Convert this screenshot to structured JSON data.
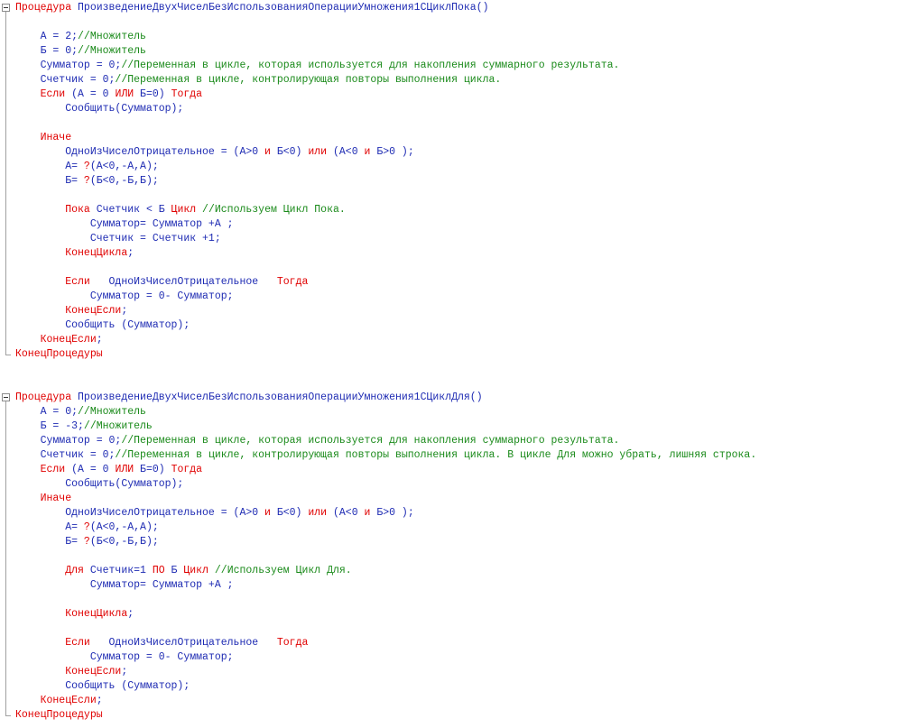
{
  "editor": {
    "colors": {
      "keyword": "#e00000",
      "identifier": "#1e2bb3",
      "comment": "#1a8a1a",
      "background": "#ffffff"
    },
    "blocks": [
      {
        "name": "procedure-while",
        "lines": [
          [
            [
              "kw",
              "Процедура"
            ],
            [
              "id",
              " ПроизведениеДвухЧиселБезИспользованияОперацииУмножения1СЦиклПока()"
            ]
          ],
          [],
          [
            [
              "id",
              "    А = 2;"
            ],
            [
              "cm",
              "//Множитель"
            ]
          ],
          [
            [
              "id",
              "    Б = 0;"
            ],
            [
              "cm",
              "//Множитель"
            ]
          ],
          [
            [
              "id",
              "    Сумматор = 0;"
            ],
            [
              "cm",
              "//Переменная в цикле, которая используется для накопления суммарного результата."
            ]
          ],
          [
            [
              "id",
              "    Счетчик = 0;"
            ],
            [
              "cm",
              "//Переменная в цикле, контролирующая повторы выполнения цикла."
            ]
          ],
          [
            [
              "kw",
              "    Если"
            ],
            [
              "id",
              " (А = 0 "
            ],
            [
              "kw",
              "ИЛИ"
            ],
            [
              "id",
              " Б=0) "
            ],
            [
              "kw",
              "Тогда"
            ]
          ],
          [
            [
              "id",
              "        Сообщить(Сумматор);"
            ]
          ],
          [],
          [
            [
              "kw",
              "    Иначе"
            ]
          ],
          [
            [
              "id",
              "        ОдноИзЧиселОтрицательное = (А>0 "
            ],
            [
              "kw",
              "и"
            ],
            [
              "id",
              " Б<0) "
            ],
            [
              "kw",
              "или"
            ],
            [
              "id",
              " (А<0 "
            ],
            [
              "kw",
              "и"
            ],
            [
              "id",
              " Б>0 );"
            ]
          ],
          [
            [
              "id",
              "        А= "
            ],
            [
              "kw",
              "?"
            ],
            [
              "id",
              "(А<0,-А,А);"
            ]
          ],
          [
            [
              "id",
              "        Б= "
            ],
            [
              "kw",
              "?"
            ],
            [
              "id",
              "(Б<0,-Б,Б);"
            ]
          ],
          [],
          [
            [
              "kw",
              "        Пока"
            ],
            [
              "id",
              " Счетчик < Б "
            ],
            [
              "kw",
              "Цикл"
            ],
            [
              "cm",
              " //Используем Цикл Пока."
            ]
          ],
          [
            [
              "id",
              "            Сумматор= Сумматор +А ;"
            ]
          ],
          [
            [
              "id",
              "            Счетчик = Счетчик +1;"
            ]
          ],
          [
            [
              "kw",
              "        КонецЦикла"
            ],
            [
              "id",
              ";"
            ]
          ],
          [],
          [
            [
              "kw",
              "        Если"
            ],
            [
              "id",
              "   ОдноИзЧиселОтрицательное   "
            ],
            [
              "kw",
              "Тогда"
            ]
          ],
          [
            [
              "id",
              "            Сумматор = 0- Сумматор;"
            ]
          ],
          [
            [
              "kw",
              "        КонецЕсли"
            ],
            [
              "id",
              ";"
            ]
          ],
          [
            [
              "id",
              "        Сообщить (Сумматор);"
            ]
          ],
          [
            [
              "kw",
              "    КонецЕсли"
            ],
            [
              "id",
              ";"
            ]
          ],
          [
            [
              "kw",
              "КонецПроцедуры"
            ]
          ]
        ]
      },
      {
        "name": "procedure-for",
        "lines": [
          [
            [
              "kw",
              "Процедура"
            ],
            [
              "id",
              " ПроизведениеДвухЧиселБезИспользованияОперацииУмножения1СЦиклДля()"
            ]
          ],
          [
            [
              "id",
              "    А = 0;"
            ],
            [
              "cm",
              "//Множитель"
            ]
          ],
          [
            [
              "id",
              "    Б = -3;"
            ],
            [
              "cm",
              "//Множитель"
            ]
          ],
          [
            [
              "id",
              "    Сумматор = 0;"
            ],
            [
              "cm",
              "//Переменная в цикле, которая используется для накопления суммарного результата."
            ]
          ],
          [
            [
              "id",
              "    Счетчик = 0;"
            ],
            [
              "cm",
              "//Переменная в цикле, контролирующая повторы выполнения цикла. В цикле Для можно убрать, лишняя строка."
            ]
          ],
          [
            [
              "kw",
              "    Если"
            ],
            [
              "id",
              " (А = 0 "
            ],
            [
              "kw",
              "ИЛИ"
            ],
            [
              "id",
              " Б=0) "
            ],
            [
              "kw",
              "Тогда"
            ]
          ],
          [
            [
              "id",
              "        Сообщить(Сумматор);"
            ]
          ],
          [
            [
              "kw",
              "    Иначе"
            ]
          ],
          [
            [
              "id",
              "        ОдноИзЧиселОтрицательное = (А>0 "
            ],
            [
              "kw",
              "и"
            ],
            [
              "id",
              " Б<0) "
            ],
            [
              "kw",
              "или"
            ],
            [
              "id",
              " (А<0 "
            ],
            [
              "kw",
              "и"
            ],
            [
              "id",
              " Б>0 );"
            ]
          ],
          [
            [
              "id",
              "        А= "
            ],
            [
              "kw",
              "?"
            ],
            [
              "id",
              "(А<0,-А,А);"
            ]
          ],
          [
            [
              "id",
              "        Б= "
            ],
            [
              "kw",
              "?"
            ],
            [
              "id",
              "(Б<0,-Б,Б);"
            ]
          ],
          [],
          [
            [
              "kw",
              "        Для"
            ],
            [
              "id",
              " Счетчик=1 "
            ],
            [
              "kw",
              "ПО"
            ],
            [
              "id",
              " Б "
            ],
            [
              "kw",
              "Цикл"
            ],
            [
              "cm",
              " //Используем Цикл Для."
            ]
          ],
          [
            [
              "id",
              "            Сумматор= Сумматор +А ;"
            ]
          ],
          [],
          [
            [
              "kw",
              "        КонецЦикла"
            ],
            [
              "id",
              ";"
            ]
          ],
          [],
          [
            [
              "kw",
              "        Если"
            ],
            [
              "id",
              "   ОдноИзЧиселОтрицательное   "
            ],
            [
              "kw",
              "Тогда"
            ]
          ],
          [
            [
              "id",
              "            Сумматор = 0- Сумматор;"
            ]
          ],
          [
            [
              "kw",
              "        КонецЕсли"
            ],
            [
              "id",
              ";"
            ]
          ],
          [
            [
              "id",
              "        Сообщить (Сумматор);"
            ]
          ],
          [
            [
              "kw",
              "    КонецЕсли"
            ],
            [
              "id",
              ";"
            ]
          ],
          [
            [
              "kw",
              "КонецПроцедуры"
            ]
          ]
        ]
      }
    ]
  }
}
